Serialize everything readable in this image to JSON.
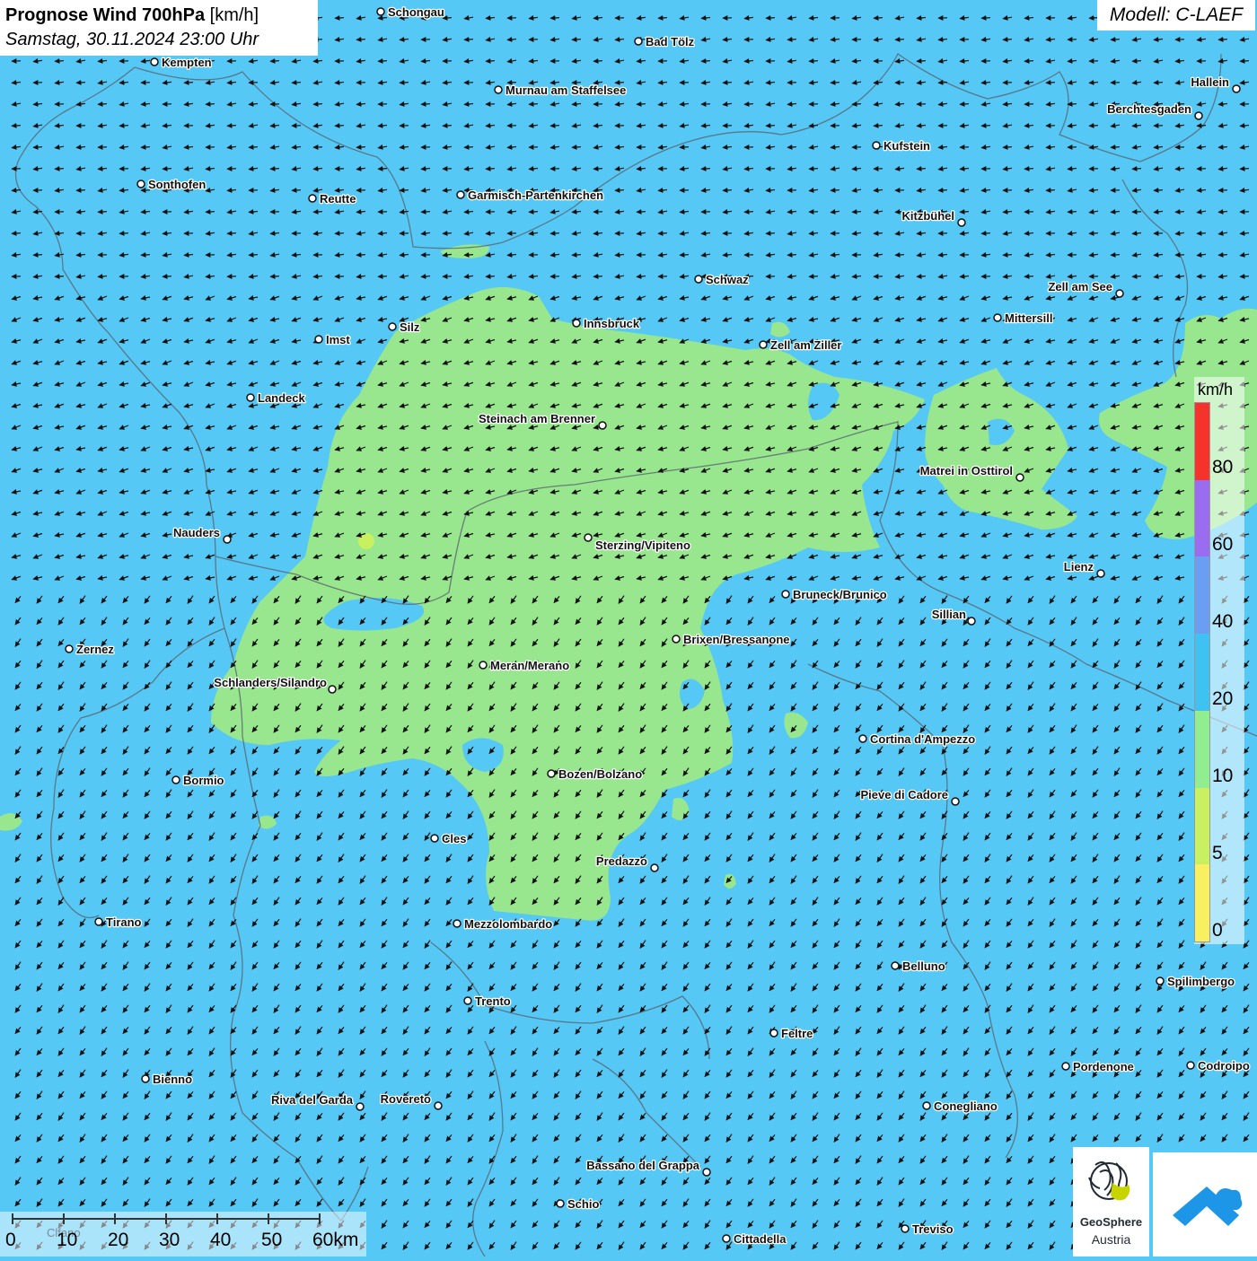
{
  "header": {
    "title_bold": "Prognose Wind 700hPa",
    "title_unit": "[km/h]",
    "datetime": "Samstag, 30.11.2024 23:00 Uhr",
    "model": "Modell: C-LAEF"
  },
  "legend": {
    "unit": "km/h",
    "labels": [
      "80",
      "60",
      "40",
      "20",
      "10",
      "5",
      "0"
    ],
    "colors": [
      "#f5332a",
      "#9a6cf0",
      "#6a9ef2",
      "#3ec2f2",
      "#90ee90",
      "#c8f060",
      "#f8f060"
    ]
  },
  "scalebar": {
    "labels": [
      "0",
      "10",
      "20",
      "30",
      "40",
      "50",
      "60km"
    ],
    "faint_text": "Clfano"
  },
  "colors": {
    "ocean_blue": "#55c8f5",
    "calm_green": "#98e68e",
    "border": "#5a6470"
  },
  "cities": [
    {
      "name": "Schongau"
    },
    {
      "name": "Bad Tölz"
    },
    {
      "name": "Kempten"
    },
    {
      "name": "Murnau am Staffelsee"
    },
    {
      "name": "Hallein"
    },
    {
      "name": "Berchtesgaden"
    },
    {
      "name": "Kufstein"
    },
    {
      "name": "Sonthofen"
    },
    {
      "name": "Reutte"
    },
    {
      "name": "Garmisch-Partenkirchen"
    },
    {
      "name": "Kitzbühel"
    },
    {
      "name": "Schwaz"
    },
    {
      "name": "Zell am See"
    },
    {
      "name": "Innsbruck"
    },
    {
      "name": "Mittersill"
    },
    {
      "name": "Silz"
    },
    {
      "name": "Imst"
    },
    {
      "name": "Zell am Ziller"
    },
    {
      "name": "Landeck"
    },
    {
      "name": "Steinach am Brenner"
    },
    {
      "name": "Matrei in Osttirol"
    },
    {
      "name": "Nauders"
    },
    {
      "name": "Sterzing/Vipiteno"
    },
    {
      "name": "Lienz"
    },
    {
      "name": "Bruneck/Brunico"
    },
    {
      "name": "Sillian"
    },
    {
      "name": "Zernez"
    },
    {
      "name": "Brixen/Bressanone"
    },
    {
      "name": "Meran/Merano"
    },
    {
      "name": "Schlanders/Silandro"
    },
    {
      "name": "Cortina d'Ampezzo"
    },
    {
      "name": "Bozen/Bolzano"
    },
    {
      "name": "Bormio"
    },
    {
      "name": "Pieve di Cadore"
    },
    {
      "name": "Cles"
    },
    {
      "name": "Predazzo"
    },
    {
      "name": "Tirano"
    },
    {
      "name": "Mezzolombardo"
    },
    {
      "name": "Belluno"
    },
    {
      "name": "Spilimbergo"
    },
    {
      "name": "Trento"
    },
    {
      "name": "Feltre"
    },
    {
      "name": "Pordenone"
    },
    {
      "name": "Codroipo"
    },
    {
      "name": "Bienno"
    },
    {
      "name": "Riva del Garda"
    },
    {
      "name": "Rovereto"
    },
    {
      "name": "Conegliano"
    },
    {
      "name": "Bassano del Grappa"
    },
    {
      "name": "Schio"
    },
    {
      "name": "Treviso"
    },
    {
      "name": "Cittadella"
    }
  ],
  "logo": {
    "name": "GeoSphere",
    "sub": "Austria"
  }
}
